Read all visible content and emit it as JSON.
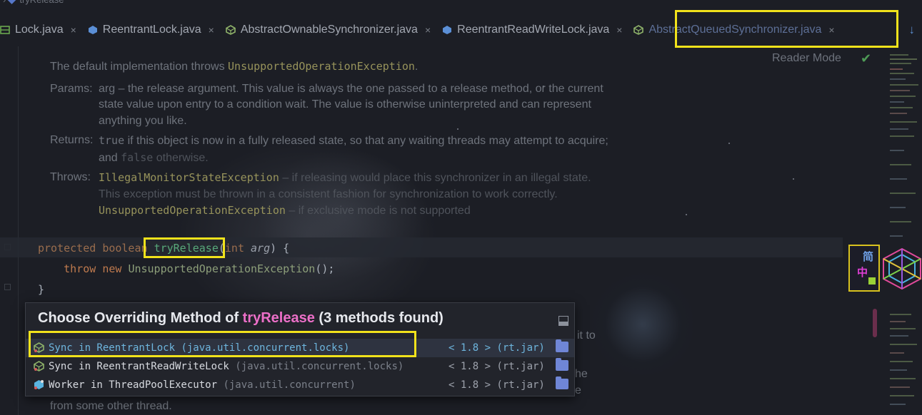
{
  "breadcrumb": {
    "item": "tryRelease"
  },
  "tabs": [
    {
      "label": "Lock.java",
      "close": "×",
      "icon": "interface-icon",
      "color": "#6aa84f"
    },
    {
      "label": "ReentrantLock.java",
      "close": "×",
      "icon": "class-icon",
      "color": "#5b8fd6"
    },
    {
      "label": "AbstractOwnableSynchronizer.java",
      "close": "×",
      "icon": "abstract-class-icon",
      "color": "#8fb36a"
    },
    {
      "label": "ReentrantReadWriteLock.java",
      "close": "×",
      "icon": "class-icon",
      "color": "#5b8fd6"
    },
    {
      "label": "AbstractQueuedSynchronizer.java",
      "close": "×",
      "icon": "abstract-class-icon",
      "color": "#8fb36a",
      "active": true
    }
  ],
  "reader_mode": "Reader Mode",
  "doc": {
    "default_impl_prefix": "The default implementation throws ",
    "default_impl_exception": "UnsupportedOperationException",
    "default_impl_suffix": ".",
    "params_label": "Params:",
    "params_text": "arg – the release argument. This value is always the one passed to a release method, or the current state value upon entry to a condition wait. The value is otherwise uninterpreted and can represent anything you like.",
    "returns_label": "Returns:",
    "returns_true": "true",
    "returns_mid": " if this object is now in a fully released state, so that any waiting threads may attempt to acquire; and ",
    "returns_false": "false",
    "returns_end": " otherwise.",
    "throws_label": "Throws:",
    "throws_1_name": "IllegalMonitorStateException",
    "throws_1_text": " – if releasing would place this synchronizer in an illegal state. This exception must be thrown in a consistent fashion for synchronization to work correctly.",
    "throws_2_name": "UnsupportedOperationException",
    "throws_2_text": " – if exclusive mode is not supported"
  },
  "code": {
    "line1": {
      "kw1": "protected",
      "kw2": "boolean",
      "method": "tryRelease",
      "open": "(",
      "ptype": "int",
      "pname": "arg",
      "close": ") {"
    },
    "line2": {
      "kw1": "throw",
      "kw2": "new",
      "type": "UnsupportedOperationException",
      "rest": "();"
    },
    "line3": "}"
  },
  "popup": {
    "title_prefix": "Choose Overriding Method of ",
    "title_method": "tryRelease",
    "title_suffix": " (3 methods found)",
    "rows": [
      {
        "main": "Sync in ReentrantLock",
        "pkg": " (java.util.concurrent.locks)",
        "ver": "< 1.8 > (rt.jar)",
        "selected": true
      },
      {
        "main": "Sync in ReentrantReadWriteLock",
        "pkg": " (java.util.concurrent.locks)",
        "ver": "< 1.8 > (rt.jar)",
        "selected": false
      },
      {
        "main": "Worker in ThreadPoolExecutor",
        "pkg": " (java.util.concurrent)",
        "ver": "< 1.8 > (rt.jar)",
        "selected": false
      }
    ]
  },
  "background_fragments": {
    "frag1": "it to",
    "frag2": "he",
    "frag3": "e",
    "frag4": "from some other thread."
  },
  "ime": {
    "char1": "简",
    "char2": "中"
  },
  "colors": {
    "highlight": "#f1e21b",
    "accent": "#ec6fc8",
    "selection": "#6eb6de"
  }
}
